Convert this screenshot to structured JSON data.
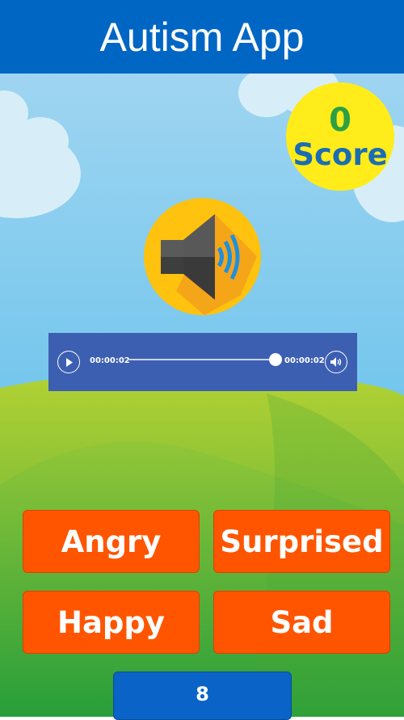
{
  "app": {
    "title": "Autism App"
  },
  "score": {
    "value": "0",
    "label": "Score"
  },
  "player": {
    "current_time": "00:00:02",
    "duration": "00:00:02",
    "progress": 1.0
  },
  "answers": [
    {
      "label": "Angry"
    },
    {
      "label": "Surprised"
    },
    {
      "label": "Happy"
    },
    {
      "label": "Sad"
    }
  ],
  "counter": {
    "value": "8"
  },
  "colors": {
    "header": "#0066c4",
    "answer_bg": "#ff5500",
    "score_bg": "#ffec1a",
    "score_value": "#2ea043",
    "score_label": "#1b6db3",
    "player_bg": "#3d5fb2"
  },
  "icons": {
    "speaker": "speaker-icon",
    "play": "play-icon",
    "volume": "volume-icon"
  }
}
